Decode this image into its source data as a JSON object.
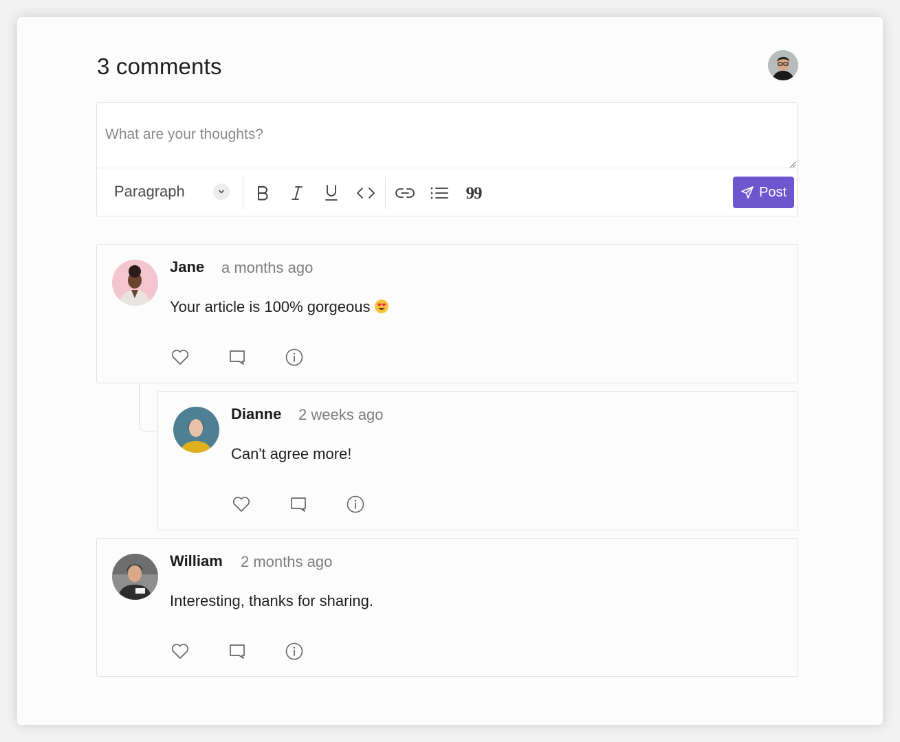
{
  "header": {
    "title": "3 comments"
  },
  "current_user": {
    "avatar": "user-avatar-photo"
  },
  "composer": {
    "placeholder": "What are your thoughts?",
    "block_format": "Paragraph",
    "toolbar_icons": [
      "bold-icon",
      "italic-icon",
      "underline-icon",
      "code-icon",
      "link-icon",
      "list-icon",
      "quote-icon"
    ],
    "quote_glyph": "99",
    "post_label": "Post",
    "accent_color": "#6e56cf"
  },
  "comments": [
    {
      "author": "Jane",
      "time": "a months ago",
      "text": "Your article is 100% gorgeous",
      "emoji": "heart-eyes-emoji",
      "avatar_bg": "#f3c6cf",
      "is_reply": false
    },
    {
      "author": "Dianne",
      "time": "2 weeks ago",
      "text": "Can't agree more!",
      "avatar_bg": "#4f7f93",
      "is_reply": true
    },
    {
      "author": "William",
      "time": "2 months ago",
      "text": "Interesting, thanks for sharing.",
      "avatar_bg": "#5a5a5a",
      "is_reply": false
    }
  ],
  "actions": [
    "heart-icon",
    "comment-icon",
    "info-icon"
  ],
  "colors": {
    "text": "#1f1f1f",
    "muted": "#7d7d7d",
    "border": "#e2e2e2",
    "background": "#fcfcfc"
  }
}
